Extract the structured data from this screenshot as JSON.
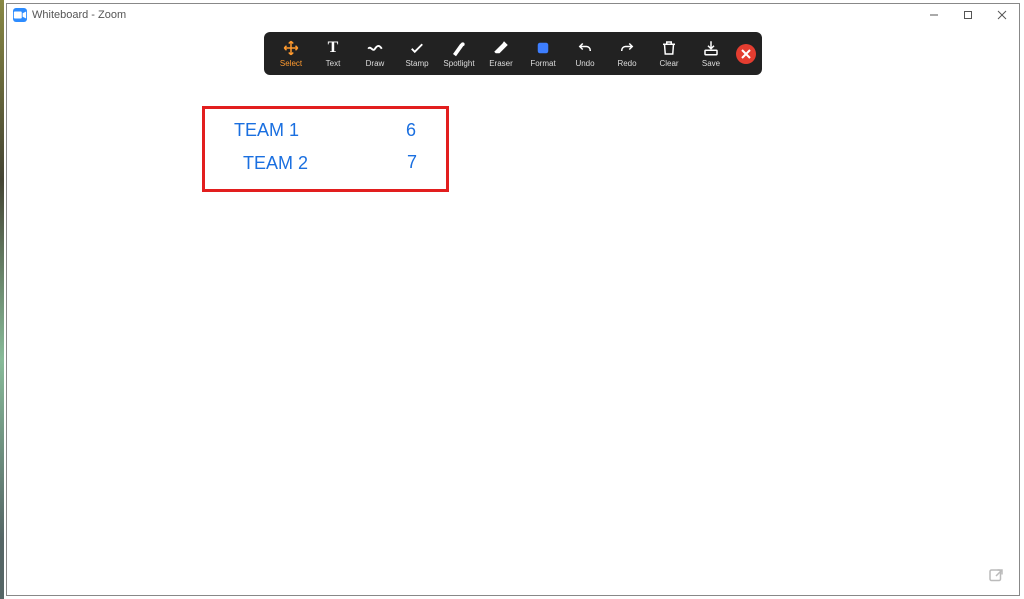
{
  "window": {
    "title": "Whiteboard - Zoom",
    "app_icon_label": "▭"
  },
  "toolbar": {
    "items": [
      {
        "id": "select",
        "label": "Select",
        "selected": true
      },
      {
        "id": "text",
        "label": "Text",
        "selected": false
      },
      {
        "id": "draw",
        "label": "Draw",
        "selected": false
      },
      {
        "id": "stamp",
        "label": "Stamp",
        "selected": false
      },
      {
        "id": "spotlight",
        "label": "Spotlight",
        "selected": false
      },
      {
        "id": "eraser",
        "label": "Eraser",
        "selected": false
      },
      {
        "id": "format",
        "label": "Format",
        "selected": false
      },
      {
        "id": "undo",
        "label": "Undo",
        "selected": false
      },
      {
        "id": "redo",
        "label": "Redo",
        "selected": false
      },
      {
        "id": "clear",
        "label": "Clear",
        "selected": false
      },
      {
        "id": "save",
        "label": "Save",
        "selected": false
      }
    ]
  },
  "whiteboard": {
    "rows": [
      {
        "label": "TEAM 1",
        "value": "6"
      },
      {
        "label": "TEAM 2",
        "value": "7"
      }
    ]
  }
}
